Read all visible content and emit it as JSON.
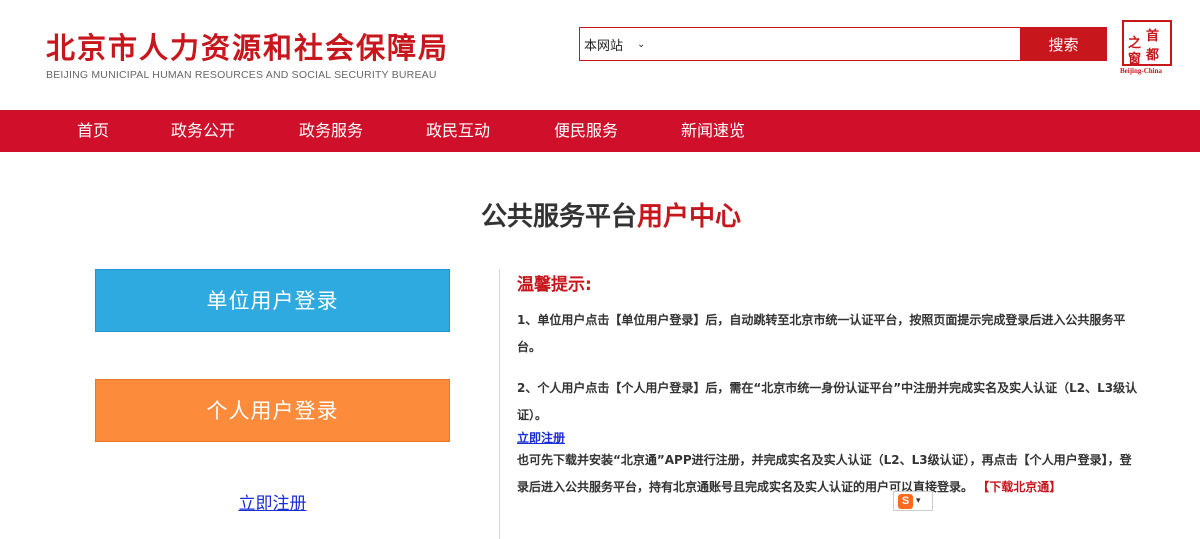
{
  "header": {
    "title": "北京市人力资源和社会保障局",
    "subtitle": "BEIJING MUNICIPAL HUMAN RESOURCES AND SOCIAL SECURITY BUREAU",
    "seal": {
      "chars": [
        "首",
        "都",
        "之",
        "窗"
      ],
      "en": "Beijing-China"
    }
  },
  "search": {
    "scope": "本网站",
    "value": "",
    "placeholder": "",
    "button_label": "搜索"
  },
  "nav": {
    "items": [
      {
        "label": "首页"
      },
      {
        "label": "政务公开"
      },
      {
        "label": "政务服务"
      },
      {
        "label": "政民互动"
      },
      {
        "label": "便民服务"
      },
      {
        "label": "新闻速览"
      }
    ]
  },
  "main": {
    "title_part1": "公共服务平台",
    "title_part2": "用户中心",
    "unit_login_label": "单位用户登录",
    "person_login_label": "个人用户登录",
    "register_label": "立即注册"
  },
  "tips": {
    "title": "温馨提示:",
    "item1": "1、单位用户点击【单位用户登录】后，自动跳转至北京市统一认证平台，按照页面提示完成登录后进入公共服务平台。",
    "item2": "2、个人用户点击【个人用户登录】后，需在“北京市统一身份认证平台”中注册并完成实名及实人认证（L2、L3级认证）。",
    "register_link": "立即注册",
    "item3": "也可先下载并安装“北京通”APP进行注册，并完成实名及实人认证（L2、L3级认证），再点击【个人用户登录】，登录后进入公共服务平台，持有北京通账号且完成实名及实人认证的用户可以直接登录。",
    "download_link": "【下载北京通】"
  },
  "colors": {
    "brand_red": "#c8161d",
    "nav_red": "#d0102a",
    "unit_blue": "#2eaae1",
    "person_orange": "#fc8b3b",
    "link_blue": "#1a2ed8"
  },
  "icons": {
    "ime": "sogou-ime-icon"
  }
}
